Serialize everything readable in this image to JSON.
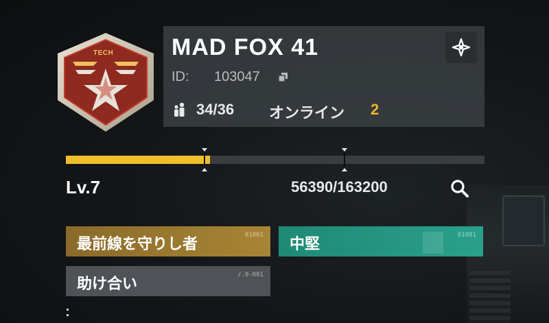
{
  "emblem": {
    "text": "TECH",
    "icon": "clan-emblem-star"
  },
  "player": {
    "name": "MAD FOX 41",
    "id_label": "ID:",
    "id_value": "103047",
    "members": "34/36",
    "online_label": "オンライン",
    "online_count": "2"
  },
  "level": {
    "label": "Lv.7",
    "xp_text": "56390/163200",
    "xp_fraction": 0.345
  },
  "tags": [
    {
      "label": "最前線を守りし者",
      "code": "01001"
    },
    {
      "label": "中堅",
      "code": "01001"
    },
    {
      "label": "助け合い",
      "code": "/.0-R01"
    }
  ],
  "colors": {
    "accent": "#f2bf2c",
    "gold_tag": "#a88535",
    "teal_tag": "#2aa08a",
    "gray_tag": "#4f5256",
    "panel": "#3e4246"
  },
  "icons": [
    "copy-icon",
    "members-icon",
    "settings-icon",
    "search-icon"
  ]
}
